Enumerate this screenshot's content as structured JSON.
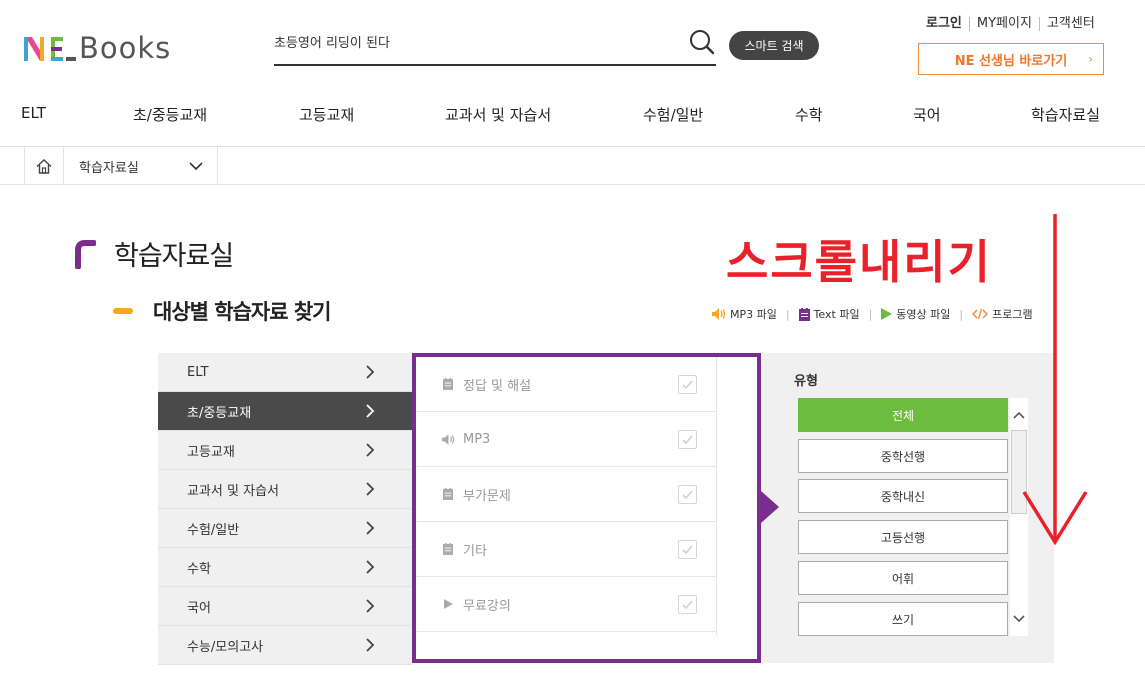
{
  "header": {
    "logo_text": "Books",
    "search_placeholder": "초등영어 리딩이 된다",
    "smart_search_label": "스마트 검색",
    "util_links": [
      "로그인",
      "MY페이지",
      "고객센터"
    ],
    "teacher_button": "NE 선생님 바로가기"
  },
  "gnb": [
    "ELT",
    "초/중등교재",
    "고등교재",
    "교과서 및 자습서",
    "수험/일반",
    "수학",
    "국어",
    "학습자료실"
  ],
  "breadcrumb": {
    "current": "학습자료실"
  },
  "page_title": "학습자료실",
  "section_title": "대상별 학습자료 찾기",
  "annotation": "스크롤내리기",
  "legend": [
    {
      "label": "MP3 파일",
      "icon": "speaker-icon",
      "color": "#f5a623"
    },
    {
      "label": "Text 파일",
      "icon": "document-icon",
      "color": "#7b2d8e"
    },
    {
      "label": "동영상 파일",
      "icon": "play-icon",
      "color": "#6dbb3f"
    },
    {
      "label": "프로그램",
      "icon": "code-icon",
      "color": "#f08a3c"
    }
  ],
  "categories": [
    {
      "label": "ELT",
      "active": false
    },
    {
      "label": "초/중등교재",
      "active": true
    },
    {
      "label": "고등교재",
      "active": false
    },
    {
      "label": "교과서 및 자습서",
      "active": false
    },
    {
      "label": "수험/일반",
      "active": false
    },
    {
      "label": "수학",
      "active": false
    },
    {
      "label": "국어",
      "active": false
    },
    {
      "label": "수능/모의고사",
      "active": false
    }
  ],
  "materials": [
    {
      "label": "정답 및 해설",
      "icon": "document-icon"
    },
    {
      "label": "MP3",
      "icon": "speaker-icon"
    },
    {
      "label": "부가문제",
      "icon": "document-icon"
    },
    {
      "label": "기타",
      "icon": "document-icon"
    },
    {
      "label": "무료강의",
      "icon": "play-icon"
    }
  ],
  "type_panel": {
    "label": "유형",
    "options": [
      {
        "label": "전체",
        "active": true
      },
      {
        "label": "중학선행",
        "active": false
      },
      {
        "label": "중학내신",
        "active": false
      },
      {
        "label": "고등선행",
        "active": false
      },
      {
        "label": "어휘",
        "active": false
      },
      {
        "label": "쓰기",
        "active": false
      }
    ]
  },
  "colors": {
    "accent_purple": "#7b2d8e",
    "accent_green": "#6dbb3f",
    "accent_orange": "#f08a3c",
    "annotation_red": "#e8212b"
  }
}
